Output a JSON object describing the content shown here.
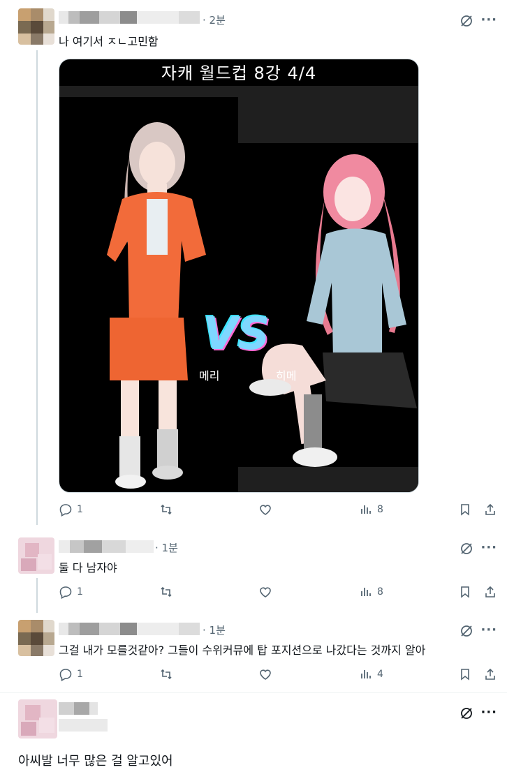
{
  "posts": [
    {
      "time": "2분",
      "text": "나 여기서 ㅈㄴ고민함",
      "stats": {
        "replies": "1",
        "views": "8"
      },
      "media": {
        "title": "자캐 월드컵   8강   4/4",
        "left_name": "메리",
        "right_name": "히메",
        "vs": "VS"
      }
    },
    {
      "time": "1분",
      "text": "둘 다 남자야",
      "stats": {
        "replies": "1",
        "views": "8"
      }
    },
    {
      "time": "1분",
      "text": "그걸 내가 모를것같아? 그들이 수위커뮤에 탑 포지션으로 나갔다는 것까지 알아",
      "stats": {
        "replies": "1",
        "views": "4"
      }
    },
    {
      "text": "아씨발 너무 많은 걸 알고있어"
    }
  ],
  "icons": {
    "reply": "reply-icon",
    "repost": "repost-icon",
    "like": "heart-icon",
    "views": "views-bar-icon",
    "bookmark": "bookmark-icon",
    "share": "share-icon",
    "grok": "grok-icon",
    "more": "more-icon"
  },
  "colors": {
    "muted": "#536471",
    "thread_line": "#cfd9de",
    "vs_gradient": [
      "#3ee6ff",
      "#9b5cff",
      "#ff6ad5"
    ],
    "left_outfit": "#f26b3a",
    "right_hair": "#f08aa0"
  }
}
